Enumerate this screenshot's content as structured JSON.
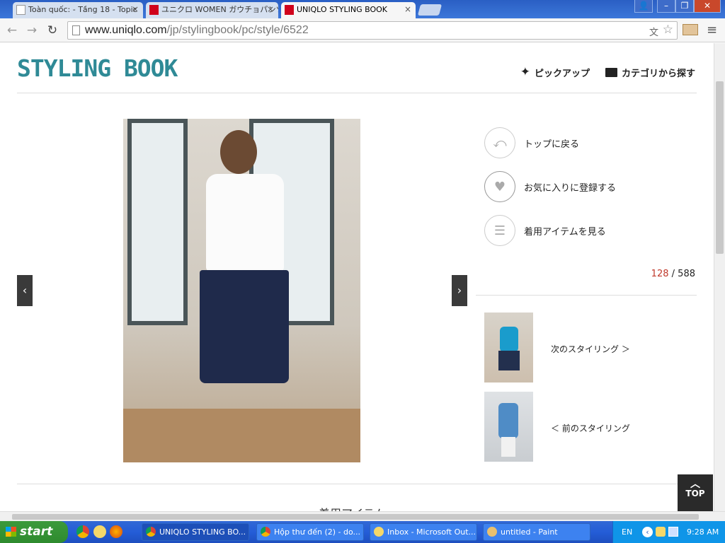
{
  "browser": {
    "tabs": [
      {
        "title": "Toàn quốc: - Tầng 18 - Topic",
        "active": false
      },
      {
        "title": "ユニクロ WOMEN ガウチョパンツ",
        "active": false
      },
      {
        "title": "UNIQLO STYLING BOOK",
        "active": true
      }
    ],
    "url_domain": "www.uniqlo.com",
    "url_path": "/jp/stylingbook/pc/style/6522"
  },
  "site": {
    "logo": "STYLING BOOK",
    "nav_pickup": "ピックアップ",
    "nav_category": "カテゴリから探す"
  },
  "actions": {
    "back_top": "トップに戻る",
    "favorite": "お気に入りに登録する",
    "items": "着用アイテムを見る"
  },
  "pager": {
    "current": "128",
    "separator": "/",
    "total": "588"
  },
  "styling_nav": {
    "next": "次のスタイリング ＞",
    "prev": "＜ 前のスタイリング"
  },
  "section_partial": "着用アイテム",
  "top_button": "TOP",
  "taskbar": {
    "start": "start",
    "tasks": [
      {
        "label": "UNIQLO STYLING BO...",
        "active": true
      },
      {
        "label": "Hộp thư đến (2) - do...",
        "active": false
      },
      {
        "label": "Inbox - Microsoft Out...",
        "active": false
      },
      {
        "label": "untitled - Paint",
        "active": false
      }
    ],
    "lang": "EN",
    "time": "9:28 AM"
  },
  "colors": {
    "logo": "#2f8a96",
    "counter_current": "#c0392b"
  }
}
